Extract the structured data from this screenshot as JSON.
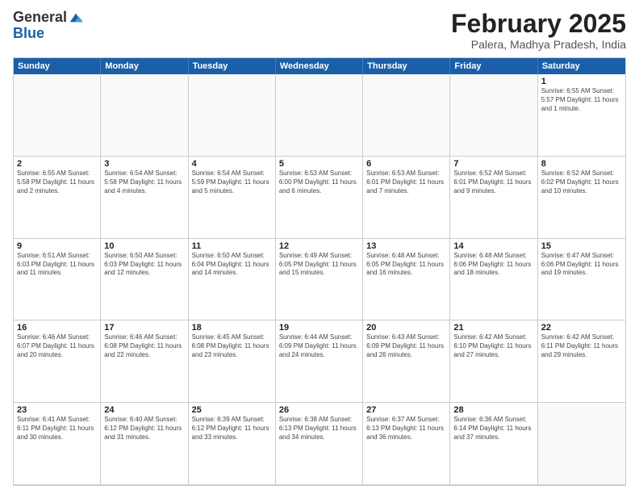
{
  "header": {
    "logo_general": "General",
    "logo_blue": "Blue",
    "title": "February 2025",
    "subtitle": "Palera, Madhya Pradesh, India"
  },
  "calendar": {
    "days_of_week": [
      "Sunday",
      "Monday",
      "Tuesday",
      "Wednesday",
      "Thursday",
      "Friday",
      "Saturday"
    ],
    "weeks": [
      [
        {
          "day": "",
          "info": "",
          "empty": true
        },
        {
          "day": "",
          "info": "",
          "empty": true
        },
        {
          "day": "",
          "info": "",
          "empty": true
        },
        {
          "day": "",
          "info": "",
          "empty": true
        },
        {
          "day": "",
          "info": "",
          "empty": true
        },
        {
          "day": "",
          "info": "",
          "empty": true
        },
        {
          "day": "1",
          "info": "Sunrise: 6:55 AM\nSunset: 5:57 PM\nDaylight: 11 hours\nand 1 minute.",
          "empty": false
        }
      ],
      [
        {
          "day": "2",
          "info": "Sunrise: 6:55 AM\nSunset: 5:58 PM\nDaylight: 11 hours\nand 2 minutes.",
          "empty": false
        },
        {
          "day": "3",
          "info": "Sunrise: 6:54 AM\nSunset: 5:58 PM\nDaylight: 11 hours\nand 4 minutes.",
          "empty": false
        },
        {
          "day": "4",
          "info": "Sunrise: 6:54 AM\nSunset: 5:59 PM\nDaylight: 11 hours\nand 5 minutes.",
          "empty": false
        },
        {
          "day": "5",
          "info": "Sunrise: 6:53 AM\nSunset: 6:00 PM\nDaylight: 11 hours\nand 6 minutes.",
          "empty": false
        },
        {
          "day": "6",
          "info": "Sunrise: 6:53 AM\nSunset: 6:01 PM\nDaylight: 11 hours\nand 7 minutes.",
          "empty": false
        },
        {
          "day": "7",
          "info": "Sunrise: 6:52 AM\nSunset: 6:01 PM\nDaylight: 11 hours\nand 9 minutes.",
          "empty": false
        },
        {
          "day": "8",
          "info": "Sunrise: 6:52 AM\nSunset: 6:02 PM\nDaylight: 11 hours\nand 10 minutes.",
          "empty": false
        }
      ],
      [
        {
          "day": "9",
          "info": "Sunrise: 6:51 AM\nSunset: 6:03 PM\nDaylight: 11 hours\nand 11 minutes.",
          "empty": false
        },
        {
          "day": "10",
          "info": "Sunrise: 6:50 AM\nSunset: 6:03 PM\nDaylight: 11 hours\nand 12 minutes.",
          "empty": false
        },
        {
          "day": "11",
          "info": "Sunrise: 6:50 AM\nSunset: 6:04 PM\nDaylight: 11 hours\nand 14 minutes.",
          "empty": false
        },
        {
          "day": "12",
          "info": "Sunrise: 6:49 AM\nSunset: 6:05 PM\nDaylight: 11 hours\nand 15 minutes.",
          "empty": false
        },
        {
          "day": "13",
          "info": "Sunrise: 6:48 AM\nSunset: 6:05 PM\nDaylight: 11 hours\nand 16 minutes.",
          "empty": false
        },
        {
          "day": "14",
          "info": "Sunrise: 6:48 AM\nSunset: 6:06 PM\nDaylight: 11 hours\nand 18 minutes.",
          "empty": false
        },
        {
          "day": "15",
          "info": "Sunrise: 6:47 AM\nSunset: 6:06 PM\nDaylight: 11 hours\nand 19 minutes.",
          "empty": false
        }
      ],
      [
        {
          "day": "16",
          "info": "Sunrise: 6:46 AM\nSunset: 6:07 PM\nDaylight: 11 hours\nand 20 minutes.",
          "empty": false
        },
        {
          "day": "17",
          "info": "Sunrise: 6:46 AM\nSunset: 6:08 PM\nDaylight: 11 hours\nand 22 minutes.",
          "empty": false
        },
        {
          "day": "18",
          "info": "Sunrise: 6:45 AM\nSunset: 6:08 PM\nDaylight: 11 hours\nand 23 minutes.",
          "empty": false
        },
        {
          "day": "19",
          "info": "Sunrise: 6:44 AM\nSunset: 6:09 PM\nDaylight: 11 hours\nand 24 minutes.",
          "empty": false
        },
        {
          "day": "20",
          "info": "Sunrise: 6:43 AM\nSunset: 6:09 PM\nDaylight: 11 hours\nand 26 minutes.",
          "empty": false
        },
        {
          "day": "21",
          "info": "Sunrise: 6:42 AM\nSunset: 6:10 PM\nDaylight: 11 hours\nand 27 minutes.",
          "empty": false
        },
        {
          "day": "22",
          "info": "Sunrise: 6:42 AM\nSunset: 6:11 PM\nDaylight: 11 hours\nand 29 minutes.",
          "empty": false
        }
      ],
      [
        {
          "day": "23",
          "info": "Sunrise: 6:41 AM\nSunset: 6:11 PM\nDaylight: 11 hours\nand 30 minutes.",
          "empty": false
        },
        {
          "day": "24",
          "info": "Sunrise: 6:40 AM\nSunset: 6:12 PM\nDaylight: 11 hours\nand 31 minutes.",
          "empty": false
        },
        {
          "day": "25",
          "info": "Sunrise: 6:39 AM\nSunset: 6:12 PM\nDaylight: 11 hours\nand 33 minutes.",
          "empty": false
        },
        {
          "day": "26",
          "info": "Sunrise: 6:38 AM\nSunset: 6:13 PM\nDaylight: 11 hours\nand 34 minutes.",
          "empty": false
        },
        {
          "day": "27",
          "info": "Sunrise: 6:37 AM\nSunset: 6:13 PM\nDaylight: 11 hours\nand 36 minutes.",
          "empty": false
        },
        {
          "day": "28",
          "info": "Sunrise: 6:36 AM\nSunset: 6:14 PM\nDaylight: 11 hours\nand 37 minutes.",
          "empty": false
        },
        {
          "day": "",
          "info": "",
          "empty": true
        }
      ]
    ]
  }
}
